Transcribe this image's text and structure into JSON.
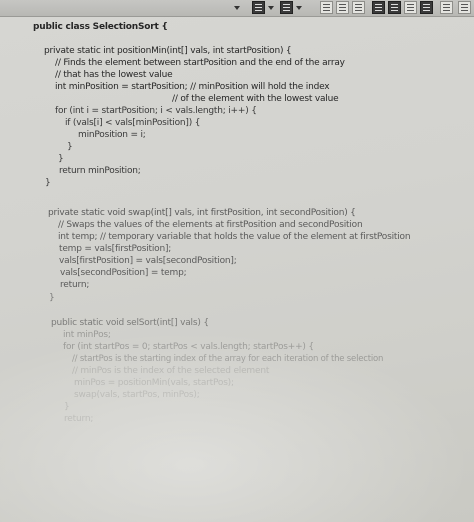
{
  "code_lines": [
    "public class SelectionSort {",
    "private static int positionMin(int[] vals, int startPosition) {",
    "// Finds the element between startPosition and the end of the array",
    "// that has the lowest value",
    "int minPosition = startPosition; // minPosition will hold the index",
    "// of the element with the lowest value",
    "for (int i = startPosition; i < vals.length; i++) {",
    "if (vals[i] < vals[minPosition]) {",
    "minPosition = i;",
    "}",
    "}",
    "return minPosition;",
    "}",
    "private static void swap(int[] vals, int firstPosition, int secondPosition) {",
    "// Swaps the values of the elements at firstPosition and secondPosition",
    "int temp; // temporary variable that holds the value of the element at firstPosition",
    "temp = vals[firstPosition];",
    "vals[firstPosition] = vals[secondPosition];",
    "vals[secondPosition] = temp;",
    "return;",
    "}",
    "public static void selSort(int[] vals) {",
    "int minPos;",
    "for (int startPos = 0; startPos < vals.length; startPos++) {",
    "// startPos is the starting index of the array for each iteration of the selection",
    "// minPos is the index of the selected element",
    "minPos = positionMin(vals, startPos);",
    "swap(vals, startPos, minPos);",
    "}",
    "return;"
  ]
}
